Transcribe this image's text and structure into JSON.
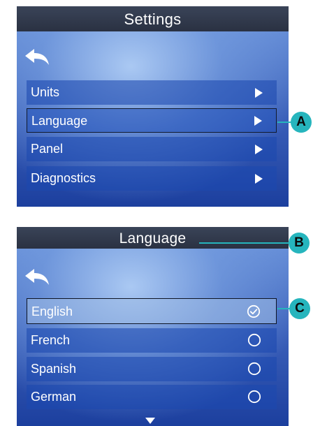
{
  "settings_screen": {
    "title": "Settings",
    "items": [
      {
        "label": "Units"
      },
      {
        "label": "Language"
      },
      {
        "label": "Panel"
      },
      {
        "label": "Diagnostics"
      }
    ]
  },
  "language_screen": {
    "title": "Language",
    "options": [
      {
        "label": "English",
        "selected": true
      },
      {
        "label": "French",
        "selected": false
      },
      {
        "label": "Spanish",
        "selected": false
      },
      {
        "label": "German",
        "selected": false
      }
    ]
  },
  "callouts": {
    "a": "A",
    "b": "B",
    "c": "C"
  },
  "icons": {
    "back": "back-arrow-icon",
    "submenu": "play-arrow-icon",
    "selected": "check-circle-icon",
    "unselected": "empty-circle-icon",
    "scroll": "scroll-down-icon"
  },
  "colors": {
    "callout": "#26b5bd",
    "titlebar": "#2a3142",
    "screen_bg": "#3a5fb9"
  }
}
